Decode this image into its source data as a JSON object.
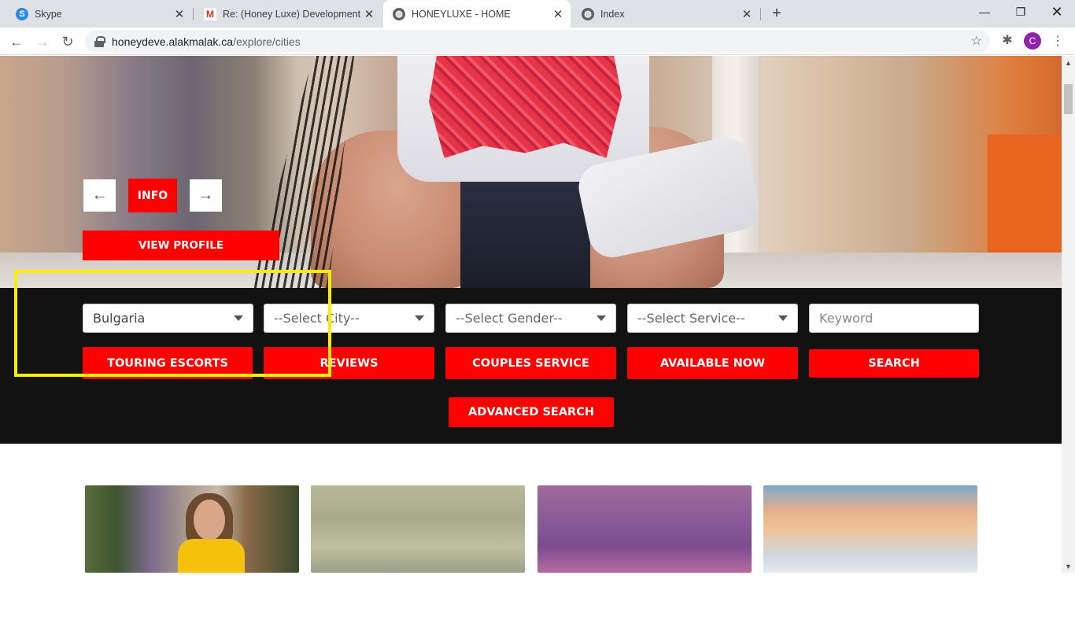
{
  "browser": {
    "tabs": [
      {
        "title": "Skype",
        "favicon": "skype-icon",
        "active": false
      },
      {
        "title": "Re: (Honey Luxe) Development -",
        "favicon": "gmail-icon",
        "active": false
      },
      {
        "title": "HONEYLUXE - HOME",
        "favicon": "globe-icon",
        "active": true
      },
      {
        "title": "Index",
        "favicon": "globe-icon",
        "active": false
      }
    ],
    "new_tab": "+",
    "url_host": "honeydeve.alakmalak.ca",
    "url_path": "/explore/cities",
    "profile_initial": "C",
    "colors": {
      "profile": "#8e24aa",
      "accent": "#ff0000",
      "highlight": "#ffed00"
    }
  },
  "hero": {
    "prev_icon": "arrow-left-icon",
    "next_icon": "arrow-right-icon",
    "info_label": "INFO",
    "view_profile_label": "VIEW PROFILE"
  },
  "search": {
    "country": "Bulgaria",
    "city": "--Select City--",
    "gender": "--Select Gender--",
    "service": "--Select Service--",
    "keyword_placeholder": "Keyword",
    "touring_label": "TOURING ESCORTS",
    "reviews_label": "REVIEWS",
    "couples_label": "COUPLES SERVICE",
    "available_label": "AVAILABLE NOW",
    "search_label": "SEARCH",
    "advanced_label": "ADVANCED SEARCH"
  }
}
